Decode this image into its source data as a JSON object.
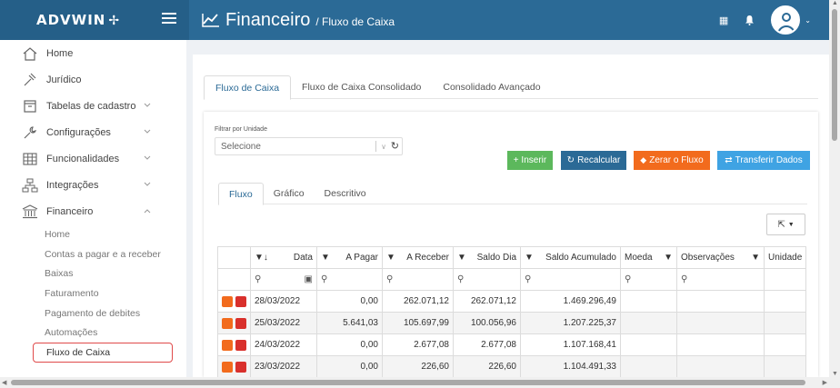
{
  "brand": "ADVWIN",
  "header": {
    "title": "Financeiro",
    "subtitle": "/ Fluxo de Caixa"
  },
  "sidebar": {
    "items": [
      {
        "label": "Home",
        "icon": "home-icon"
      },
      {
        "label": "Jurídico",
        "icon": "gavel-icon"
      },
      {
        "label": "Tabelas de cadastro",
        "icon": "archive-icon"
      },
      {
        "label": "Configurações",
        "icon": "wrench-icon"
      },
      {
        "label": "Funcionalidades",
        "icon": "grid-icon"
      },
      {
        "label": "Integrações",
        "icon": "sitemap-icon"
      },
      {
        "label": "Financeiro",
        "icon": "bank-icon"
      }
    ],
    "subitems": [
      "Home",
      "Contas a pagar e a receber",
      "Baixas",
      "Faturamento",
      "Pagamento de debites",
      "Automações",
      "Fluxo de Caixa"
    ]
  },
  "tabs": [
    "Fluxo de Caixa",
    "Fluxo de Caixa Consolidado",
    "Consolidado Avançado"
  ],
  "filter": {
    "label": "Filtrar por Unidade",
    "placeholder": "Selecione"
  },
  "buttons": {
    "inserir": "+ Inserir",
    "recalcular": "Recalcular",
    "zerar": "Zerar o Fluxo",
    "transferir": "Transferir Dados"
  },
  "subtabs": [
    "Fluxo",
    "Gráfico",
    "Descritivo"
  ],
  "table": {
    "columns": [
      "Data",
      "A Pagar",
      "A Receber",
      "Saldo Dia",
      "Saldo Acumulado",
      "Moeda",
      "Observações",
      "Unidade"
    ],
    "rows": [
      {
        "data": "28/03/2022",
        "pagar": "0,00",
        "receber": "262.071,12",
        "saldo": "262.071,12",
        "acumulado": "1.469.296,49"
      },
      {
        "data": "25/03/2022",
        "pagar": "5.641,03",
        "receber": "105.697,99",
        "saldo": "100.056,96",
        "acumulado": "1.207.225,37"
      },
      {
        "data": "24/03/2022",
        "pagar": "0,00",
        "receber": "2.677,08",
        "saldo": "2.677,08",
        "acumulado": "1.107.168,41"
      },
      {
        "data": "23/03/2022",
        "pagar": "0,00",
        "receber": "226,60",
        "saldo": "226,60",
        "acumulado": "1.104.491,33"
      }
    ]
  },
  "colors": {
    "primary": "#2b6a96",
    "success": "#5cb85c",
    "warning": "#f26b1d",
    "info": "#3fa3e3",
    "danger": "#d9302c"
  }
}
